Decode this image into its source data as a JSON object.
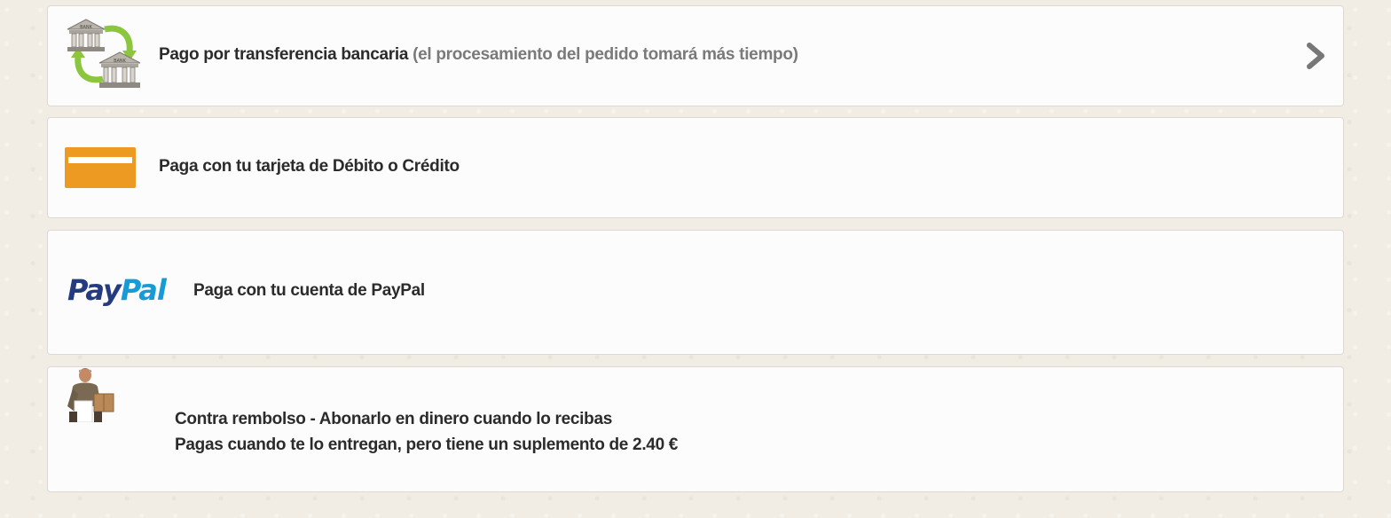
{
  "payment_options": [
    {
      "id": "bank-transfer",
      "icon": "bank-transfer-icon",
      "label": "Pago por transferencia bancaria",
      "note": "(el procesamiento del pedido tomará más tiempo)",
      "bank_icon_text": "BANK"
    },
    {
      "id": "card",
      "icon": "credit-card-icon",
      "label": "Paga con tu tarjeta de Débito o Crédito"
    },
    {
      "id": "paypal",
      "icon": "paypal-logo",
      "logo_pay": "Pay",
      "logo_pal": "Pal",
      "label": "Paga con tu cuenta de PayPal"
    },
    {
      "id": "cash-on-delivery",
      "icon": "courier-icon",
      "label": "Contra rembolso - Abonarlo en dinero cuando lo recibas",
      "sublabel": "Pagas cuando te lo entregan, pero tiene un suplemento de 2.40 €"
    }
  ],
  "colors": {
    "page_background": "#f1ede4",
    "card_orange": "#ec9a22",
    "paypal_dark_blue": "#253b80",
    "paypal_light_blue": "#179bd7",
    "text": "#2b2b2b",
    "muted_text": "#7a7a7a"
  }
}
